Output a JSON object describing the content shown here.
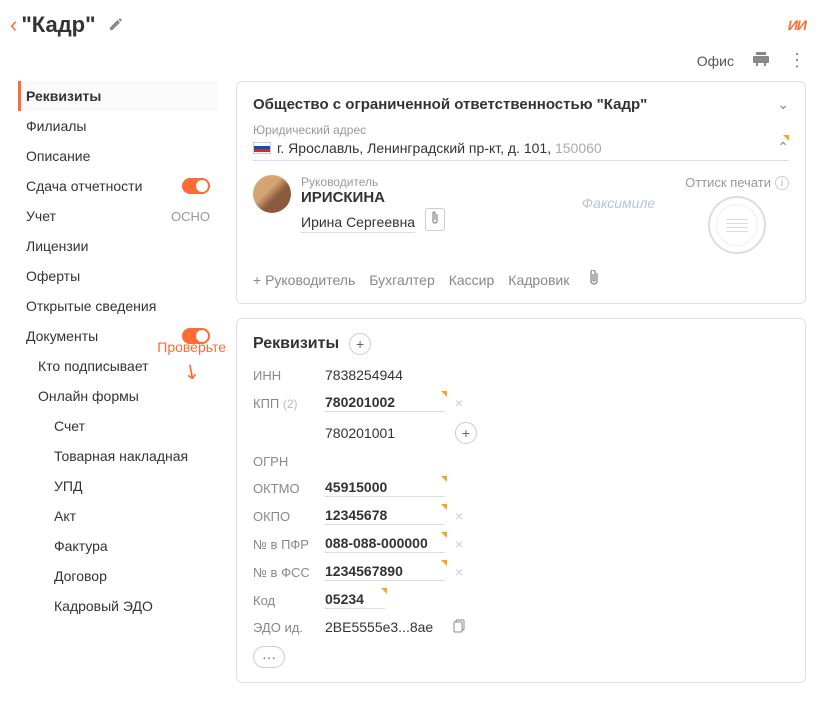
{
  "header": {
    "title": "\"Кадр\"",
    "office": "Офис",
    "ii": "ИИ"
  },
  "sidebar": {
    "items": [
      {
        "label": "Реквизиты",
        "active": true
      },
      {
        "label": "Филиалы"
      },
      {
        "label": "Описание"
      },
      {
        "label": "Сдача отчетности",
        "toggle": true
      },
      {
        "label": "Учет",
        "badge": "ОСНО"
      },
      {
        "label": "Лицензии"
      },
      {
        "label": "Оферты"
      },
      {
        "label": "Открытые сведения"
      },
      {
        "label": "Документы",
        "toggle": true
      },
      {
        "label": "Кто подписывает",
        "sub": 1
      },
      {
        "label": "Онлайн формы",
        "sub": 1
      },
      {
        "label": "Счет",
        "sub": 2
      },
      {
        "label": "Товарная накладная",
        "sub": 2
      },
      {
        "label": "УПД",
        "sub": 2
      },
      {
        "label": "Акт",
        "sub": 2
      },
      {
        "label": "Фактура",
        "sub": 2
      },
      {
        "label": "Договор",
        "sub": 2
      },
      {
        "label": "Кадровый ЭДО",
        "sub": 2
      }
    ],
    "check_hint": "Проверьте"
  },
  "org": {
    "name": "Общество с ограниченной ответственностью \"Кадр\"",
    "addr_label": "Юридический адрес",
    "addr": "г. Ярославль, Ленинградский пр-кт, д. 101,",
    "postal": "150060",
    "leader_label": "Руководитель",
    "leader_last": "ИРИСКИНА",
    "leader_first": "Ирина Сергеевна",
    "facsimile": "Факсимиле",
    "stamp_label": "Оттиск печати",
    "roles": {
      "add": "+ Руководитель",
      "r1": "Бухгалтер",
      "r2": "Кассир",
      "r3": "Кадровик"
    }
  },
  "req": {
    "title": "Реквизиты",
    "inn_label": "ИНН",
    "inn": "7838254944",
    "kpp_label": "КПП",
    "kpp_count": "(2)",
    "kpp1": "780201002",
    "kpp2": "780201001",
    "ogrn_label": "ОГРН",
    "oktmo_label": "ОКТМО",
    "oktmo": "45915000",
    "okpo_label": "ОКПО",
    "okpo": "12345678",
    "pfr_label": "№ в ПФР",
    "pfr": "088-088-000000",
    "fss_label": "№ в ФСС",
    "fss": "1234567890",
    "code_label": "Код",
    "code": "05234",
    "edo_label": "ЭДО ид.",
    "edo": "2BE5555e3...8ae"
  }
}
